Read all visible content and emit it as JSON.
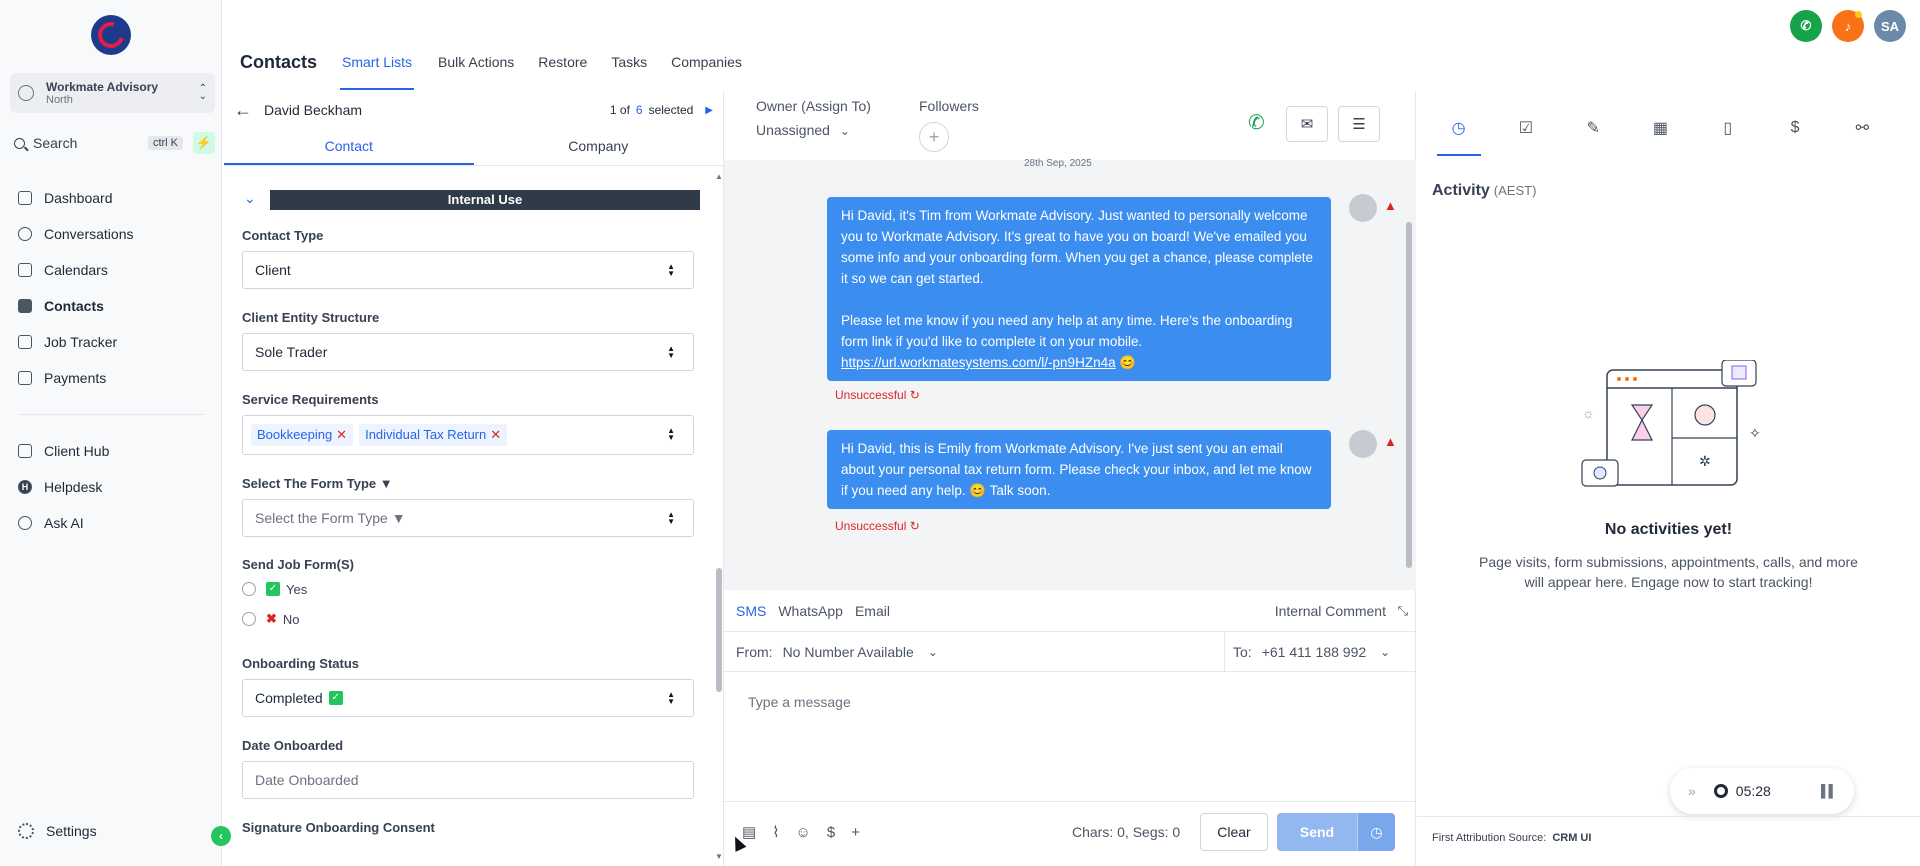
{
  "sidebar": {
    "account_name": "Workmate Advisory",
    "account_sub": "North",
    "search_label": "Search",
    "search_shortcut": "ctrl K",
    "nav": [
      {
        "label": "Dashboard",
        "icon": "dashboard-icon"
      },
      {
        "label": "Conversations",
        "icon": "chat-icon"
      },
      {
        "label": "Calendars",
        "icon": "calendar-icon"
      },
      {
        "label": "Contacts",
        "icon": "contacts-icon",
        "active": true
      },
      {
        "label": "Job Tracker",
        "icon": "job-tracker-icon"
      },
      {
        "label": "Payments",
        "icon": "payments-icon"
      }
    ],
    "nav2": [
      {
        "label": "Client Hub",
        "icon": "client-hub-icon"
      },
      {
        "label": "Helpdesk",
        "icon": "helpdesk-icon"
      },
      {
        "label": "Ask AI",
        "icon": "ask-ai-icon"
      }
    ],
    "settings_label": "Settings"
  },
  "header": {
    "title": "Contacts",
    "tabs": [
      "Smart Lists",
      "Bulk Actions",
      "Restore",
      "Tasks",
      "Companies"
    ],
    "avatar_initials": "SA"
  },
  "contact": {
    "name": "David Beckham",
    "counter_prefix": "1 of",
    "counter_total": "6",
    "counter_suffix": "selected",
    "tabs": [
      "Contact",
      "Company"
    ],
    "section_title": "Internal Use",
    "fields": {
      "contact_type_label": "Contact Type",
      "contact_type_value": "Client",
      "entity_label": "Client Entity Structure",
      "entity_value": "Sole Trader",
      "service_label": "Service Requirements",
      "service_tags": [
        "Bookkeeping",
        "Individual Tax Return"
      ],
      "form_type_label": "Select The Form Type ▼",
      "form_type_placeholder": "Select the Form Type ▼",
      "send_job_label": "Send Job Form(S)",
      "send_job_yes": "Yes",
      "send_job_no": "No",
      "onboarding_label": "Onboarding Status",
      "onboarding_value": "Completed",
      "date_label": "Date Onboarded",
      "date_placeholder": "Date Onboarded",
      "signature_label": "Signature Onboarding Consent"
    }
  },
  "conversation": {
    "owner_label": "Owner (Assign To)",
    "owner_value": "Unassigned",
    "followers_label": "Followers",
    "date_chip": "28th Sep, 2025",
    "messages": [
      {
        "p1": "Hi David, it's Tim from Workmate Advisory. Just wanted to personally welcome you to Workmate Advisory. It's great to have you on board! We've emailed you some info and your onboarding form. When you get a chance, please complete it so we can get started.",
        "p2": "Please let me know if you need any help at any time. Here's the onboarding form link if you'd like to complete it on your mobile.",
        "link": "https://url.workmatesystems.com/l/-pn9HZn4a",
        "emoji": "😊",
        "status": "Unsuccessful"
      },
      {
        "p1": "Hi David, this is Emily from Workmate Advisory. I've just sent you an email about your personal tax return form. Please check your inbox, and let me know if you need any help. 😊 Talk soon.",
        "status": "Unsuccessful"
      }
    ],
    "compose": {
      "tabs": [
        "SMS",
        "WhatsApp",
        "Email"
      ],
      "internal_comment": "Internal Comment",
      "from_label": "From:",
      "from_value": "No Number Available",
      "to_label": "To:",
      "to_value": "+61 411 188 992",
      "placeholder": "Type a message",
      "chars": "Chars: 0, Segs: 0",
      "clear": "Clear",
      "send": "Send"
    }
  },
  "activity": {
    "title": "Activity",
    "timezone": "(AEST)",
    "empty_title": "No activities yet!",
    "empty_desc": "Page visits, form submissions, appointments, calls, and more will appear here. Engage now to start tracking!",
    "timer": "05:28",
    "attribution_label": "First Attribution Source:",
    "attribution_value": "CRM UI"
  },
  "colors": {
    "accent": "#2563eb",
    "bubble": "#3b8def",
    "error": "#dc2626",
    "success": "#16a34a"
  }
}
